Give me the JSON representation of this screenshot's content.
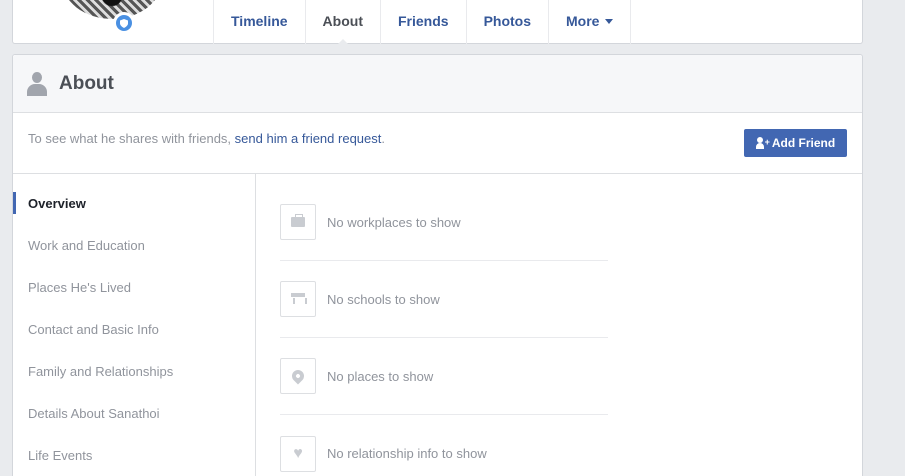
{
  "tabs": [
    {
      "label": "Timeline"
    },
    {
      "label": "About"
    },
    {
      "label": "Friends"
    },
    {
      "label": "Photos"
    },
    {
      "label": "More"
    }
  ],
  "about": {
    "title": "About",
    "request_prefix": "To see what he shares with friends, ",
    "request_link": "send him a friend request",
    "request_suffix": ".",
    "add_friend_label": "Add Friend"
  },
  "nav": [
    {
      "label": "Overview"
    },
    {
      "label": "Work and Education"
    },
    {
      "label": "Places He's Lived"
    },
    {
      "label": "Contact and Basic Info"
    },
    {
      "label": "Family and Relationships"
    },
    {
      "label": "Details About Sanathoi"
    },
    {
      "label": "Life Events"
    }
  ],
  "overview": [
    {
      "text": "No workplaces to show",
      "icon": "briefcase-icon"
    },
    {
      "text": "No schools to show",
      "icon": "school-icon"
    },
    {
      "text": "No places to show",
      "icon": "location-pin-icon"
    },
    {
      "text": "No relationship info to show",
      "icon": "heart-icon"
    }
  ],
  "colors": {
    "link": "#365899",
    "button": "#4267b2",
    "muted_text": "#90949c",
    "heading": "#4b4f56"
  }
}
